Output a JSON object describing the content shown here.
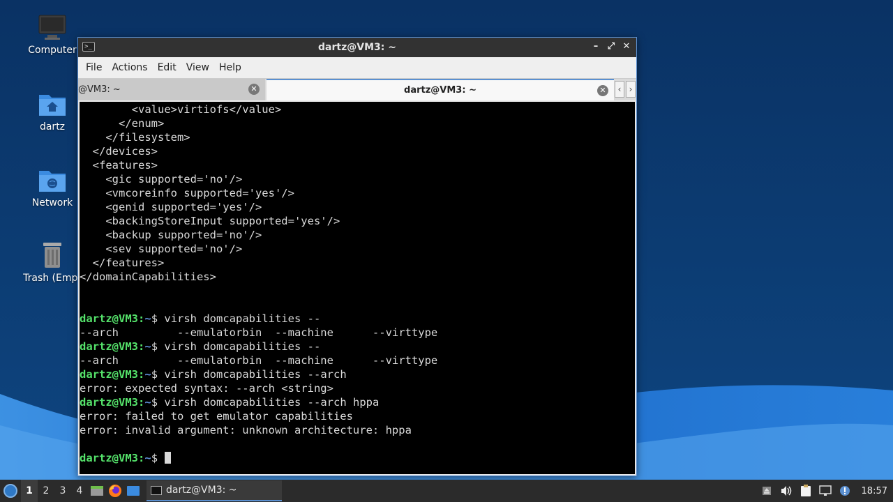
{
  "colors": {
    "desktop_dark": "#0d3a6b",
    "desktop_wave": "#2d7fd6",
    "prompt_user": "#55e36b",
    "prompt_path": "#5f8fd8",
    "terminal_bg": "#000000",
    "terminal_fg": "#d9d9d9",
    "accent": "#5a8fd0"
  },
  "desktop": {
    "icons": [
      {
        "name": "computer-icon",
        "label": "Computer"
      },
      {
        "name": "home-folder-icon",
        "label": "dartz"
      },
      {
        "name": "network-folder-icon",
        "label": "Network"
      },
      {
        "name": "trash-icon",
        "label": "Trash (Empt"
      }
    ]
  },
  "window": {
    "title": "dartz@VM3: ~",
    "app_icon": "terminal-icon",
    "controls": {
      "minimize": "–",
      "maximize": "⤢",
      "close": "✕"
    },
    "menu": [
      "File",
      "Actions",
      "Edit",
      "View",
      "Help"
    ],
    "tabs": [
      {
        "label": "@VM3: ~",
        "active": false
      },
      {
        "label": "dartz@VM3: ~",
        "active": true
      }
    ],
    "tab_scroll": {
      "left": "‹",
      "right": "›"
    }
  },
  "terminal": {
    "prompt_user": "dartz@VM3",
    "prompt_sep": ":",
    "prompt_path": "~",
    "prompt_sym": "$ ",
    "lines": [
      {
        "type": "out",
        "text": "        <value>virtiofs</value>"
      },
      {
        "type": "out",
        "text": "      </enum>"
      },
      {
        "type": "out",
        "text": "    </filesystem>"
      },
      {
        "type": "out",
        "text": "  </devices>"
      },
      {
        "type": "out",
        "text": "  <features>"
      },
      {
        "type": "out",
        "text": "    <gic supported='no'/>"
      },
      {
        "type": "out",
        "text": "    <vmcoreinfo supported='yes'/>"
      },
      {
        "type": "out",
        "text": "    <genid supported='yes'/>"
      },
      {
        "type": "out",
        "text": "    <backingStoreInput supported='yes'/>"
      },
      {
        "type": "out",
        "text": "    <backup supported='no'/>"
      },
      {
        "type": "out",
        "text": "    <sev supported='no'/>"
      },
      {
        "type": "out",
        "text": "  </features>"
      },
      {
        "type": "out",
        "text": "</domainCapabilities>"
      },
      {
        "type": "out",
        "text": ""
      },
      {
        "type": "out",
        "text": ""
      },
      {
        "type": "cmd",
        "text": "virsh domcapabilities --"
      },
      {
        "type": "out",
        "text": "--arch         --emulatorbin  --machine      --virttype"
      },
      {
        "type": "cmd",
        "text": "virsh domcapabilities --"
      },
      {
        "type": "out",
        "text": "--arch         --emulatorbin  --machine      --virttype"
      },
      {
        "type": "cmd",
        "text": "virsh domcapabilities --arch"
      },
      {
        "type": "out",
        "text": "error: expected syntax: --arch <string>"
      },
      {
        "type": "cmd",
        "text": "virsh domcapabilities --arch hppa"
      },
      {
        "type": "out",
        "text": "error: failed to get emulator capabilities"
      },
      {
        "type": "out",
        "text": "error: invalid argument: unknown architecture: hppa"
      },
      {
        "type": "out",
        "text": ""
      },
      {
        "type": "cmd",
        "text": "",
        "cursor": true
      }
    ]
  },
  "taskbar": {
    "workspaces": [
      "1",
      "2",
      "3",
      "4"
    ],
    "active_workspace": "1",
    "launchers": [
      "file-manager-icon",
      "firefox-icon",
      "show-desktop-icon"
    ],
    "task": {
      "label": "dartz@VM3: ~",
      "icon": "terminal-icon"
    },
    "tray": [
      "eject-icon",
      "volume-icon",
      "clipboard-icon",
      "network-icon",
      "update-notification-icon"
    ],
    "clock": "18:57"
  }
}
